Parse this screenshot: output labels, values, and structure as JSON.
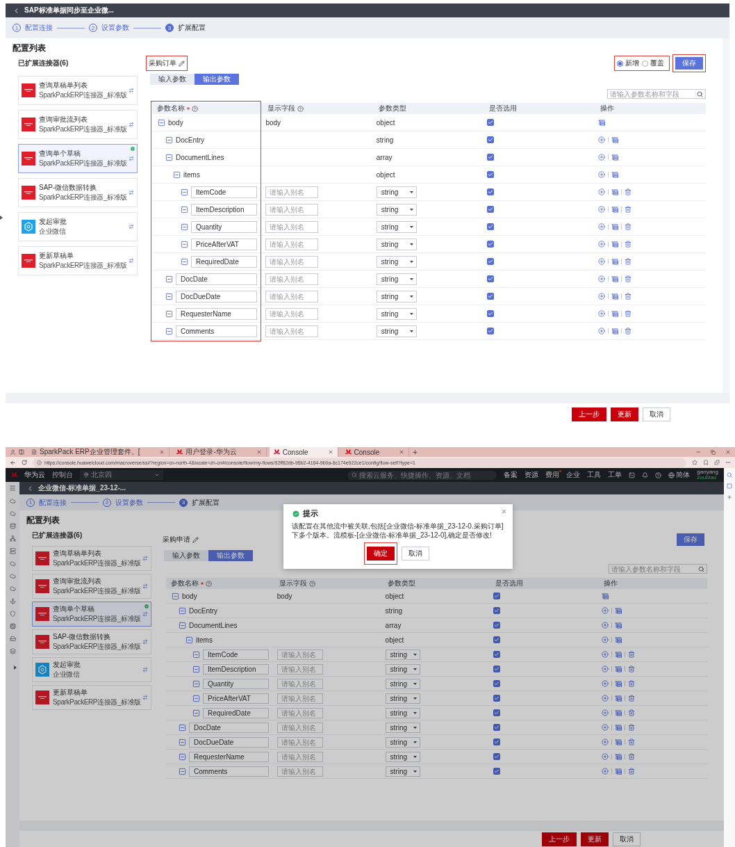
{
  "top": {
    "title": "SAP标准单据同步至企业微...",
    "steps": [
      {
        "number": "1",
        "label": "配置连接",
        "current": false
      },
      {
        "number": "2",
        "label": "设置参数",
        "current": false
      },
      {
        "number": "3",
        "label": "扩展配置",
        "current": true
      }
    ],
    "section_title": "配置列表",
    "connectors_title": "已扩展连接器(6)",
    "connectors": [
      {
        "name": "查询草稿单列表",
        "subtitle": "SparkPackERP连接器_标准版",
        "kind": "sparkpack",
        "selected": false
      },
      {
        "name": "查询审批流列表",
        "subtitle": "SparkPackERP连接器_标准版",
        "kind": "sparkpack",
        "selected": false
      },
      {
        "name": "查询单个草稿",
        "subtitle": "SparkPackERP连接器_标准版",
        "kind": "sparkpack",
        "selected": true
      },
      {
        "name": "SAP-微信数据转换",
        "subtitle": "SparkPackERP连接器_标准版",
        "kind": "sparkpack",
        "selected": false
      },
      {
        "name": "发起审批",
        "subtitle": "企业微信",
        "kind": "wecom",
        "selected": false
      },
      {
        "name": "更新草稿单",
        "subtitle": "SparkPackERP连接器_标准版",
        "kind": "sparkpack",
        "selected": false
      }
    ],
    "form": {
      "name": "采购订单",
      "name_annotated": true,
      "tabs": [
        {
          "label": "输入参数",
          "selected": false
        },
        {
          "label": "输出参数",
          "selected": true
        }
      ],
      "mode": {
        "annotated": true,
        "options": [
          {
            "label": "新增",
            "selected": true
          },
          {
            "label": "覆盖",
            "selected": false
          }
        ]
      },
      "save": {
        "label": "保存",
        "annotated": true
      },
      "search_placeholder": "请输入参数名称和字段",
      "columns": [
        {
          "label": "参数名称",
          "required": true,
          "help": true
        },
        {
          "label": "显示字段",
          "required": false,
          "help": true
        },
        {
          "label": "参数类型",
          "required": false,
          "help": false
        },
        {
          "label": "是否选用",
          "required": false,
          "help": false
        },
        {
          "label": "操作",
          "required": false,
          "help": false
        }
      ],
      "name_column_annotated": true,
      "rows": [
        {
          "name": "body",
          "editable": false,
          "alias": "body",
          "type": "object",
          "type_select": false,
          "checked": true,
          "addable": false,
          "deletable": false,
          "children": [
            {
              "name": "DocEntry",
              "editable": false,
              "type": "string",
              "type_select": false,
              "checked": true,
              "addable": true,
              "deletable": false
            },
            {
              "name": "DocumentLines",
              "editable": false,
              "type": "array",
              "type_select": false,
              "checked": true,
              "addable": true,
              "deletable": false,
              "children": [
                {
                  "name": "items",
                  "editable": false,
                  "type": "object",
                  "type_select": false,
                  "checked": true,
                  "addable": true,
                  "deletable": false,
                  "children": [
                    {
                      "name": "ItemCode",
                      "editable": true,
                      "alias_placeholder": "请输入别名",
                      "type": "string",
                      "type_select": true,
                      "checked": true,
                      "addable": true,
                      "deletable": true
                    },
                    {
                      "name": "ItemDescription",
                      "editable": true,
                      "alias_placeholder": "请输入别名",
                      "type": "string",
                      "type_select": true,
                      "checked": true,
                      "addable": true,
                      "deletable": true
                    },
                    {
                      "name": "Quantity",
                      "editable": true,
                      "alias_placeholder": "请输入别名",
                      "type": "string",
                      "type_select": true,
                      "checked": true,
                      "addable": true,
                      "deletable": true
                    },
                    {
                      "name": "PriceAfterVAT",
                      "editable": true,
                      "alias_placeholder": "请输入别名",
                      "type": "string",
                      "type_select": true,
                      "checked": true,
                      "addable": true,
                      "deletable": true
                    },
                    {
                      "name": "RequiredDate",
                      "editable": true,
                      "alias_placeholder": "请输入别名",
                      "type": "string",
                      "type_select": true,
                      "checked": true,
                      "addable": true,
                      "deletable": true
                    }
                  ]
                }
              ]
            },
            {
              "name": "DocDate",
              "editable": true,
              "alias_placeholder": "请输入别名",
              "type": "string",
              "type_select": true,
              "checked": true,
              "addable": true,
              "deletable": true
            },
            {
              "name": "DocDueDate",
              "editable": true,
              "alias_placeholder": "请输入别名",
              "type": "string",
              "type_select": true,
              "checked": true,
              "addable": true,
              "deletable": true
            },
            {
              "name": "RequesterName",
              "editable": true,
              "alias_placeholder": "请输入别名",
              "type": "string",
              "type_select": true,
              "checked": true,
              "addable": true,
              "deletable": true
            },
            {
              "name": "Comments",
              "editable": true,
              "alias_placeholder": "请输入别名",
              "type": "string",
              "type_select": true,
              "checked": true,
              "addable": true,
              "deletable": true
            }
          ]
        }
      ]
    },
    "footer_buttons": [
      {
        "label": "上一步",
        "kind": "primary"
      },
      {
        "label": "更新",
        "kind": "primary"
      },
      {
        "label": "取消",
        "kind": "default"
      }
    ]
  },
  "bottom": {
    "browser": {
      "tabs": [
        {
          "title": "SparkPack ERP企业管理套件。[",
          "kind": "page",
          "selected": false
        },
        {
          "title": "用户登录-华为云",
          "kind": "huawei",
          "selected": false
        },
        {
          "title": "Console",
          "kind": "huawei",
          "selected": true
        },
        {
          "title": "Console",
          "kind": "huawei",
          "selected": false
        }
      ],
      "url": "https://console.huaweicloud.com/macroverse/ssi/?region=cn-north-4&locale=zh-cn#/console/flow/my-flows/92ff82db-95b2-4164-9b0a-6c174e922ce1/config/flow-self?type=1"
    },
    "console": {
      "brand": "华为云",
      "console_label": "控制台",
      "region": "北京四",
      "search_placeholder": "搜索云服务、快捷操作、资源、文档",
      "nav": [
        {
          "label": "备案",
          "dot": false
        },
        {
          "label": "资源",
          "dot": false
        },
        {
          "label": "费用",
          "dot": true
        },
        {
          "label": "企业",
          "dot": false
        },
        {
          "label": "工具",
          "dot": false
        },
        {
          "label": "工单",
          "dot": false
        }
      ],
      "language": "简体",
      "user": "ganyang",
      "account": "zoubiao"
    },
    "page": {
      "title": "企业微信-标准单据_23-12-...",
      "steps": [
        {
          "number": "1",
          "label": "配置连接",
          "current": false
        },
        {
          "number": "2",
          "label": "设置参数",
          "current": false
        },
        {
          "number": "3",
          "label": "扩展配置",
          "current": true
        }
      ],
      "section_title": "配置列表",
      "connectors_title": "已扩展连接器(6)",
      "connectors": [
        {
          "name": "查询草稿单列表",
          "subtitle": "SparkPackERP连接器_标准版",
          "kind": "sparkpack",
          "selected": false
        },
        {
          "name": "查询审批流列表",
          "subtitle": "SparkPackERP连接器_标准版",
          "kind": "sparkpack",
          "selected": false
        },
        {
          "name": "查询单个草稿",
          "subtitle": "SparkPackERP连接器_标准版",
          "kind": "sparkpack",
          "selected": true
        },
        {
          "name": "SAP-微信数据转换",
          "subtitle": "SparkPackERP连接器_标准版",
          "kind": "sparkpack",
          "selected": false
        },
        {
          "name": "发起审批",
          "subtitle": "企业微信",
          "kind": "wecom",
          "selected": false
        },
        {
          "name": "更新草稿单",
          "subtitle": "SparkPackERP连接器_标准版",
          "kind": "sparkpack",
          "selected": false
        }
      ],
      "form": {
        "name": "采购申请",
        "name_annotated": false,
        "tabs": [
          {
            "label": "输入参数",
            "selected": false
          },
          {
            "label": "输出参数",
            "selected": true
          }
        ],
        "save": {
          "label": "保存",
          "annotated": false
        },
        "search_placeholder": "请输入参数名称和字段",
        "columns": [
          {
            "label": "参数名称",
            "required": true,
            "help": true
          },
          {
            "label": "显示字段",
            "required": false,
            "help": true
          },
          {
            "label": "参数类型",
            "required": false,
            "help": false
          },
          {
            "label": "是否选用",
            "required": false,
            "help": false
          },
          {
            "label": "操作",
            "required": false,
            "help": false
          }
        ],
        "name_column_annotated": false,
        "rows": [
          {
            "name": "body",
            "editable": false,
            "alias": "body",
            "type": "object",
            "type_select": false,
            "checked": true,
            "addable": false,
            "deletable": false,
            "children": [
              {
                "name": "DocEntry",
                "editable": false,
                "type": "string",
                "type_select": false,
                "checked": true,
                "addable": true,
                "deletable": false
              },
              {
                "name": "DocumentLines",
                "editable": false,
                "type": "array",
                "type_select": false,
                "checked": true,
                "addable": true,
                "deletable": false,
                "children": [
                  {
                    "name": "items",
                    "editable": false,
                    "type": "object",
                    "type_select": false,
                    "checked": true,
                    "addable": true,
                    "deletable": false,
                    "children": [
                      {
                        "name": "ItemCode",
                        "editable": true,
                        "alias_placeholder": "请输入别名",
                        "type": "string",
                        "type_select": true,
                        "checked": true,
                        "addable": true,
                        "deletable": true
                      },
                      {
                        "name": "ItemDescription",
                        "editable": true,
                        "alias_placeholder": "请输入别名",
                        "type": "string",
                        "type_select": true,
                        "checked": true,
                        "addable": true,
                        "deletable": true
                      },
                      {
                        "name": "Quantity",
                        "editable": true,
                        "alias_placeholder": "请输入别名",
                        "type": "string",
                        "type_select": true,
                        "checked": true,
                        "addable": true,
                        "deletable": true
                      },
                      {
                        "name": "PriceAfterVAT",
                        "editable": true,
                        "alias_placeholder": "请输入别名",
                        "type": "string",
                        "type_select": true,
                        "checked": true,
                        "addable": true,
                        "deletable": true
                      },
                      {
                        "name": "RequiredDate",
                        "editable": true,
                        "alias_placeholder": "请输入别名",
                        "type": "string",
                        "type_select": true,
                        "checked": true,
                        "addable": true,
                        "deletable": true
                      }
                    ]
                  }
                ]
              },
              {
                "name": "DocDate",
                "editable": true,
                "alias_placeholder": "请输入别名",
                "type": "string",
                "type_select": true,
                "checked": true,
                "addable": true,
                "deletable": true
              },
              {
                "name": "DocDueDate",
                "editable": true,
                "alias_placeholder": "请输入别名",
                "type": "string",
                "type_select": true,
                "checked": true,
                "addable": true,
                "deletable": true
              },
              {
                "name": "RequesterName",
                "editable": true,
                "alias_placeholder": "请输入别名",
                "type": "string",
                "type_select": true,
                "checked": true,
                "addable": true,
                "deletable": true
              },
              {
                "name": "Comments",
                "editable": true,
                "alias_placeholder": "请输入别名",
                "type": "string",
                "type_select": true,
                "checked": true,
                "addable": true,
                "deletable": true
              }
            ]
          }
        ]
      },
      "footer_buttons": [
        {
          "label": "上一步",
          "kind": "primary"
        },
        {
          "label": "更新",
          "kind": "primary"
        },
        {
          "label": "取消",
          "kind": "default"
        }
      ]
    },
    "dialog": {
      "title": "提示",
      "message": "该配置在其他流中被关联,包括[企业微信-标准单据_23-12-0.采购订单]下多个版本。流模板-[企业微信-标准单据_23-12-0],确定是否修改!",
      "buttons": [
        {
          "label": "确定",
          "kind": "primary",
          "annotated": true
        },
        {
          "label": "取消",
          "kind": "default",
          "annotated": false
        }
      ]
    }
  }
}
